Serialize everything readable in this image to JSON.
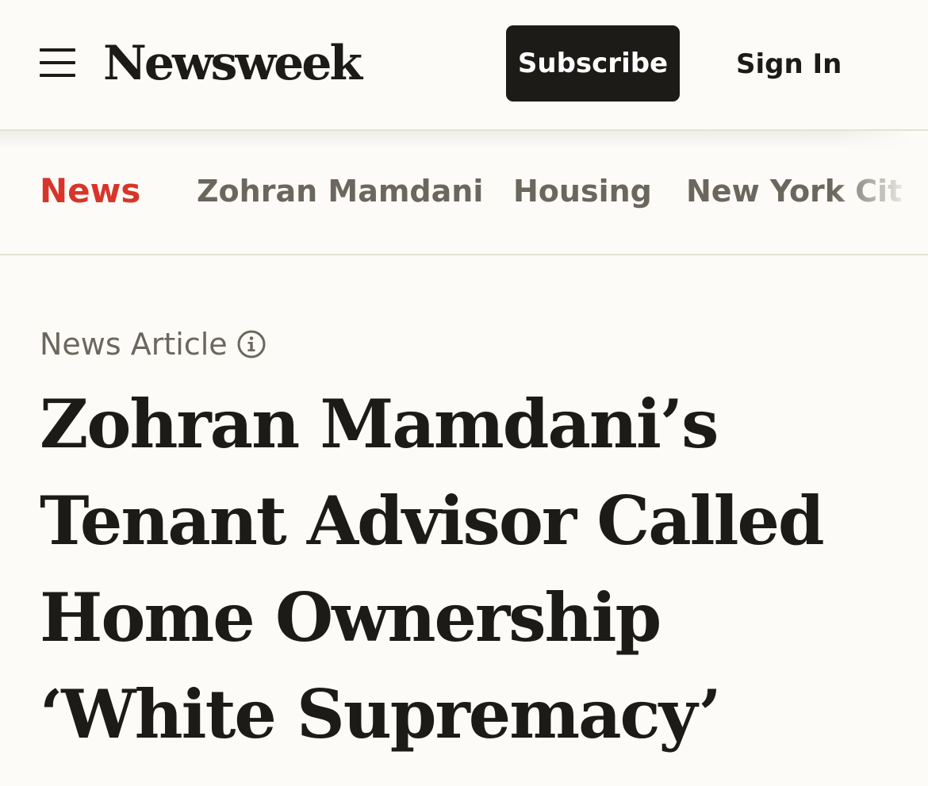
{
  "header": {
    "logo_text": "Newsweek",
    "subscribe_label": "Subscribe",
    "signin_label": "Sign In",
    "menu_icon": "hamburger-menu-icon"
  },
  "topic_nav": {
    "items": [
      {
        "label": "News",
        "active": true
      },
      {
        "label": "Zohran Mamdani",
        "active": false
      },
      {
        "label": "Housing",
        "active": false
      },
      {
        "label": "New York Cit",
        "active": false
      }
    ]
  },
  "article": {
    "type_label": "News Article",
    "type_info_icon": "info-icon",
    "headline": "Zohran Mamdani’s Tenant Advisor Called Home Ownership ‘White Supremacy’"
  },
  "colors": {
    "background": "#fcfbf7",
    "text": "#1c1b18",
    "muted": "#6b675e",
    "accent_red": "#d8352a",
    "divider": "#e6e1d6"
  }
}
